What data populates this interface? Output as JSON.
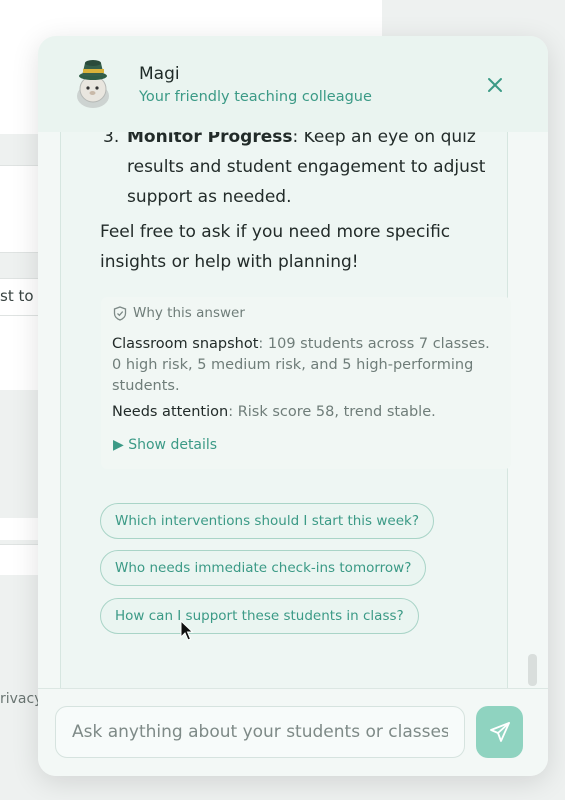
{
  "background": {
    "fragment_1": "st to C",
    "fragment_2": "rivacy"
  },
  "chat": {
    "title": "Magi",
    "subtitle": "Your friendly teaching colleague",
    "list_item": {
      "number": "3.",
      "heading": "Monitor Progress",
      "text": ": Keep an eye on quiz results and student engagement to adjust support as needed."
    },
    "closing_text": "Feel free to ask if you need more specific insights or help with planning!",
    "why": {
      "label": "Why this answer",
      "snapshot_key": "Classroom snapshot",
      "snapshot_text": ": 109 students across 7 classes. 0 high risk, 5 medium risk, and 5 high-performing students.",
      "attention_key": "Needs attention",
      "attention_text": ": Risk score 58, trend stable.",
      "show_details": "▶ Show details"
    },
    "suggestions": [
      "Which interventions should I start this week?",
      "Who needs immediate check-ins tomorrow?",
      "How can I support these students in class?"
    ],
    "input": {
      "placeholder": "Ask anything about your students or classes",
      "value": ""
    }
  },
  "colors": {
    "accent": "#3b9a86",
    "send_button": "#8fd3c0",
    "panel_background": "#f3f8f6"
  },
  "icons": {
    "avatar": "wizard-avatar",
    "close": "close-icon",
    "shield": "shield-check-icon",
    "send": "send-icon"
  }
}
